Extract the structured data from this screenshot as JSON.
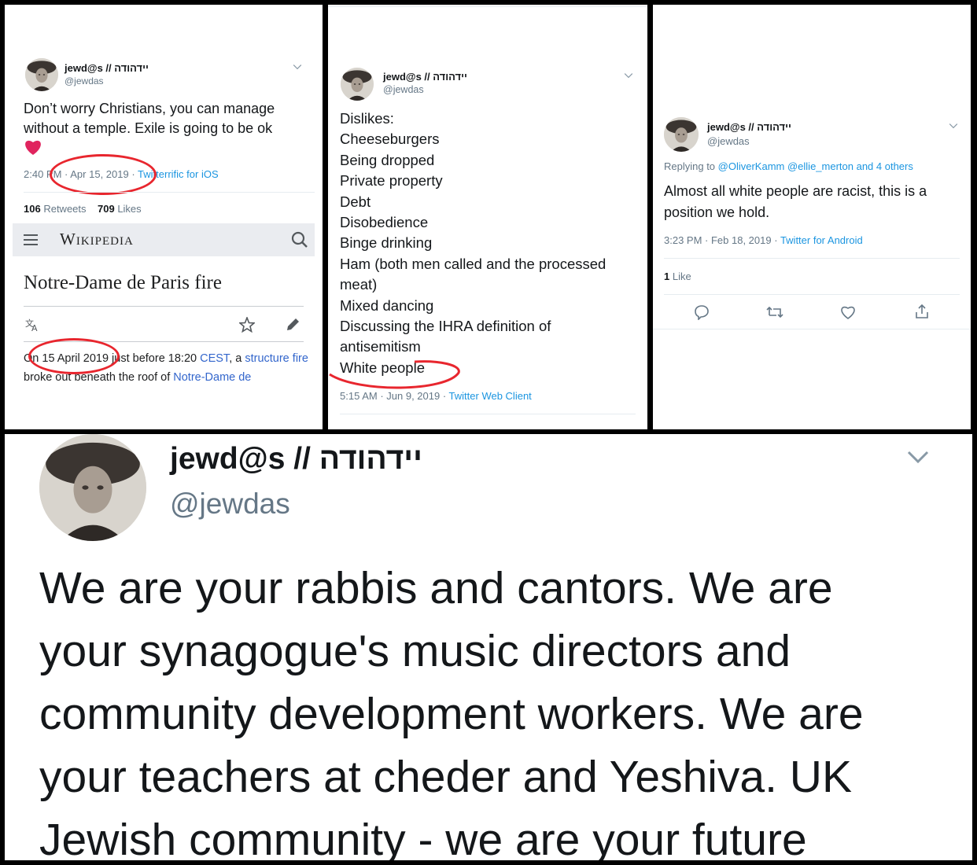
{
  "profile": {
    "name": "jewd@s // יידהודה",
    "handle": "@jewdas"
  },
  "panel1": {
    "tweet_text": "Don’t worry Christians, you can manage without a temple. Exile is going to be ok",
    "emoji": "heart",
    "time": "2:40 PM",
    "date": "Apr 15, 2019",
    "client": "Twitterrific for iOS",
    "retweets_count": "106",
    "retweets_label": "Retweets",
    "likes_count": "709",
    "likes_label": "Likes"
  },
  "wikipedia": {
    "logo": "Wikipedia",
    "article_title": "Notre-Dame de Paris fire",
    "para_on": "On ",
    "para_date": "15 April 2019",
    "para_mid": " just before 18:20 ",
    "para_cest": "CEST",
    "para_a": ", a ",
    "para_structure": "structure",
    "para_fire": "fire",
    "para_broke": " broke out beneath the roof of ",
    "para_notre": "Notre-Dame de"
  },
  "panel2": {
    "lines": [
      "Dislikes:",
      "Cheeseburgers",
      "Being dropped",
      "Private property",
      "Debt",
      "Disobedience",
      "Binge drinking",
      "Ham (both men called and the processed",
      "meat)",
      "Mixed dancing",
      "Discussing the IHRA definition of",
      "antisemitism",
      "White people"
    ],
    "time": "5:15 AM",
    "date": "Jun 9, 2019",
    "client": "Twitter Web Client"
  },
  "panel3": {
    "replying_prefix": "Replying to ",
    "replying_to": "@OliverKamm @ellie_merton and 4 others",
    "tweet_line1": "Almost all white people are racist, this is a",
    "tweet_line2": "position we hold.",
    "time": "3:23 PM",
    "date": "Feb 18, 2019",
    "client": "Twitter for Android",
    "likes_count": "1",
    "likes_label": "Like"
  },
  "panel4": {
    "lines": [
      "We are your rabbis and cantors. We are",
      "your synagogue's music directors and",
      "community development workers. We are",
      "your teachers at cheder and Yeshiva. UK",
      "Jewish community - we are your future"
    ]
  },
  "colors": {
    "link": "#1b95e0",
    "wiki_link": "#3366cc",
    "annotation_red": "#e8262e",
    "heart": "#e0245e"
  }
}
